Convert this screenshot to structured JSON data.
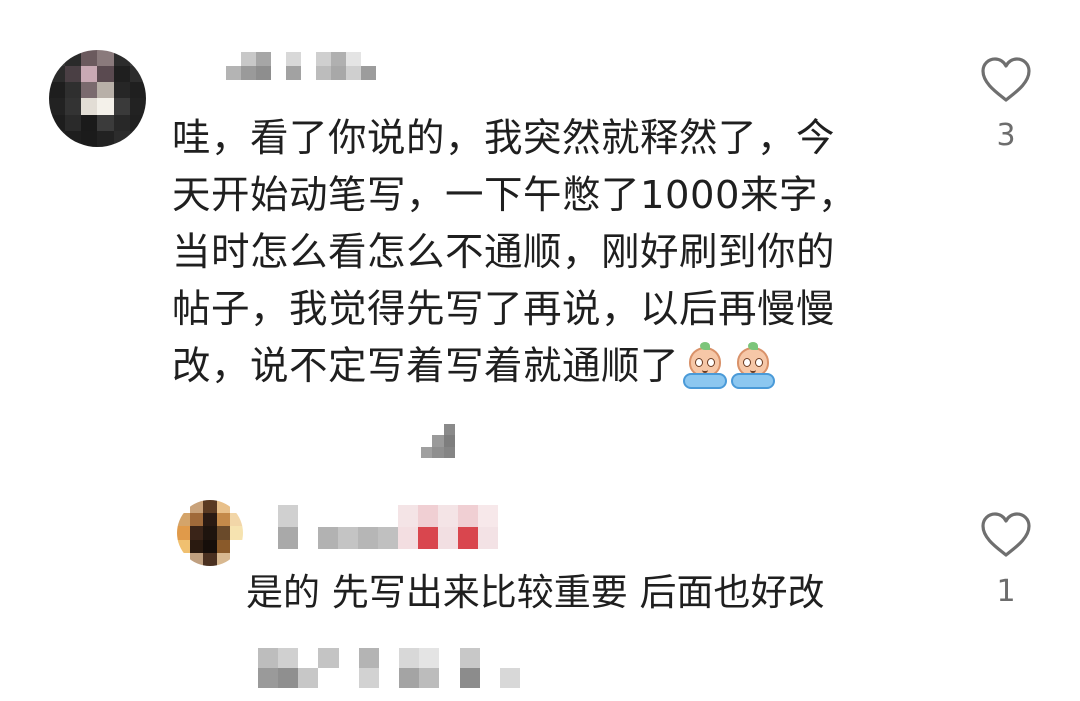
{
  "comments": [
    {
      "text_lines": [
        "哇，看了你说的，我突然就释然了，今",
        "天开始动笔写，一下午憋了1000来字，",
        "当时怎么看怎么不通顺，刚好刷到你的",
        "帖子，我觉得先写了再说，以后再慢慢",
        "改，说不定写着写着就通顺了"
      ],
      "emoji": [
        "crying-face-emoji",
        "crying-face-emoji"
      ],
      "likes": "3",
      "username_blurred": true,
      "avatar_blurred": true
    }
  ],
  "reply": {
    "text": "是的 先写出来比较重要 后面也好改",
    "likes": "1",
    "username_blurred": true,
    "avatar_blurred": true
  },
  "icons": {
    "like": "heart-outline-icon"
  },
  "colors": {
    "text": "#1f1f1f",
    "count": "#6d6d6d",
    "heart_stroke": "#6f6f6f",
    "background": "#ffffff"
  }
}
